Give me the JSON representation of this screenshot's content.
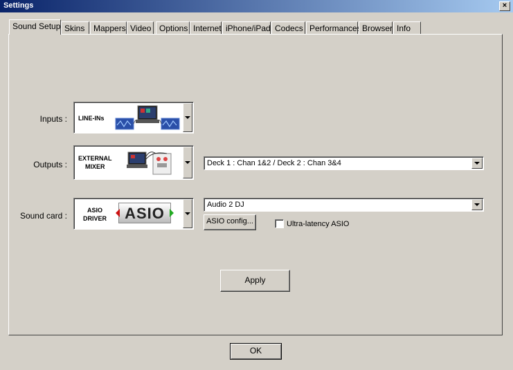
{
  "window": {
    "title": "Settings",
    "close_glyph": "×"
  },
  "tabs": [
    {
      "label": "Sound Setup",
      "active": true
    },
    {
      "label": "Skins"
    },
    {
      "label": "Mappers"
    },
    {
      "label": "Video"
    },
    {
      "label": "Options"
    },
    {
      "label": "Internet"
    },
    {
      "label": "iPhone/iPad"
    },
    {
      "label": "Codecs"
    },
    {
      "label": "Performances"
    },
    {
      "label": "Browser"
    },
    {
      "label": "Info"
    }
  ],
  "inputs": {
    "label": "Inputs :",
    "selected": "LINE-INs",
    "icon": "line-in-icon"
  },
  "outputs": {
    "label": "Outputs :",
    "selected_line1": "EXTERNAL",
    "selected_line2": "MIXER",
    "icon": "external-mixer-icon",
    "channel_value": "Deck 1 : Chan 1&2 / Deck 2 : Chan 3&4"
  },
  "soundcard": {
    "label": "Sound card :",
    "selected_line1": "ASIO",
    "selected_line2": "DRIVER",
    "logo_text": "ASIO",
    "device_value": "Audio 2 DJ",
    "config_button": "ASIO config...",
    "ultra_latency_label": "Ultra-latency ASIO",
    "ultra_latency_checked": false
  },
  "apply_button": "Apply",
  "ok_button": "OK"
}
